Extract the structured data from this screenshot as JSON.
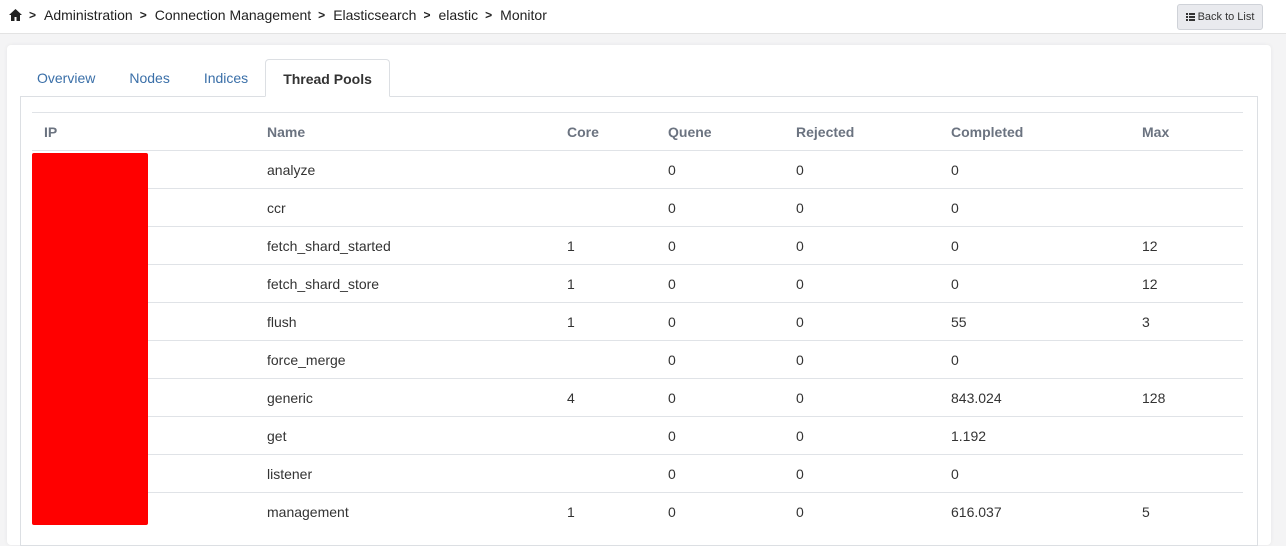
{
  "breadcrumb": [
    "Administration",
    "Connection Management",
    "Elasticsearch",
    "elastic",
    "Monitor"
  ],
  "back_button": "Back to List",
  "tabs": [
    {
      "label": "Overview"
    },
    {
      "label": "Nodes"
    },
    {
      "label": "Indices"
    },
    {
      "label": "Thread Pools"
    }
  ],
  "table": {
    "headers": [
      "IP",
      "Name",
      "Core",
      "Quene",
      "Rejected",
      "Completed",
      "Max"
    ],
    "rows": [
      [
        "",
        "analyze",
        "",
        "0",
        "0",
        "0",
        ""
      ],
      [
        "",
        "ccr",
        "",
        "0",
        "0",
        "0",
        ""
      ],
      [
        "",
        "fetch_shard_started",
        "1",
        "0",
        "0",
        "0",
        "12"
      ],
      [
        "",
        "fetch_shard_store",
        "1",
        "0",
        "0",
        "0",
        "12"
      ],
      [
        "",
        "flush",
        "1",
        "0",
        "0",
        "55",
        "3"
      ],
      [
        "",
        "force_merge",
        "",
        "0",
        "0",
        "0",
        ""
      ],
      [
        "",
        "generic",
        "4",
        "0",
        "0",
        "843.024",
        "128"
      ],
      [
        "",
        "get",
        "",
        "0",
        "0",
        "1.192",
        ""
      ],
      [
        "",
        "listener",
        "",
        "0",
        "0",
        "0",
        ""
      ],
      [
        "",
        "management",
        "1",
        "0",
        "0",
        "616.037",
        "5"
      ]
    ]
  }
}
